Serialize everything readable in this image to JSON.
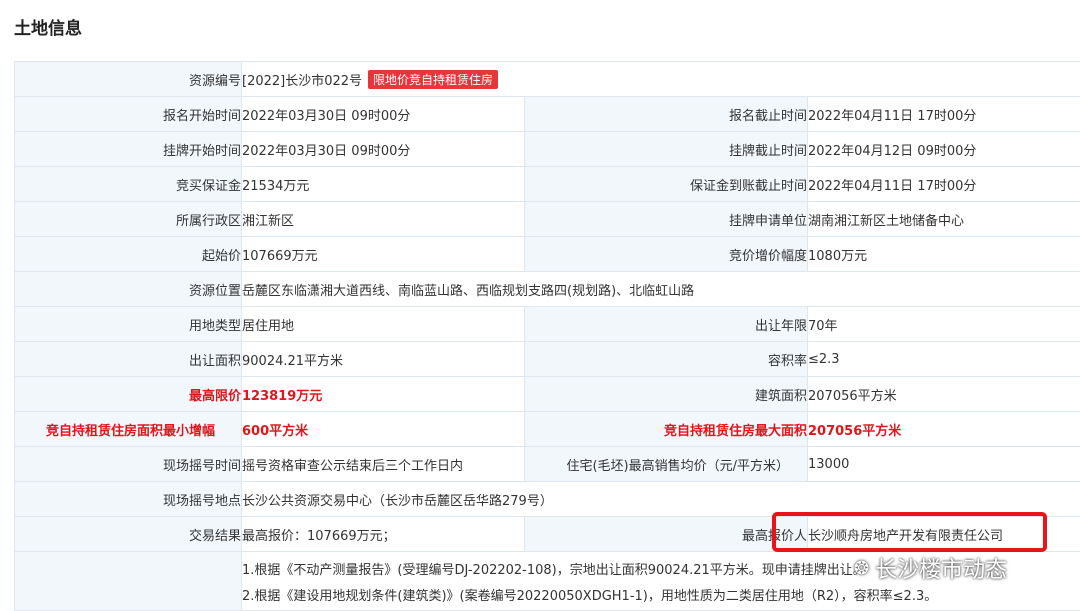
{
  "section_title": "土地信息",
  "rows": [
    {
      "label": "资源编号",
      "value": "[2022]长沙市022号",
      "tag": "限地价竞自持租赁住房"
    },
    {
      "label": "报名开始时间",
      "value": "2022年03月30日 09时00分",
      "label2": "报名截止时间",
      "value2": "2022年04月11日 17时00分"
    },
    {
      "label": "挂牌开始时间",
      "value": "2022年03月30日 09时00分",
      "label2": "挂牌截止时间",
      "value2": "2022年04月12日 09时00分"
    },
    {
      "label": "竞买保证金",
      "value": "21534万元",
      "label2": "保证金到账截止时间",
      "value2": "2022年04月11日 17时00分"
    },
    {
      "label": "所属行政区",
      "value": "湘江新区",
      "label2": "挂牌申请单位",
      "value2": "湖南湘江新区土地储备中心"
    },
    {
      "label": "起始价",
      "value": "107669万元",
      "label2": "竞价增价幅度",
      "value2": "1080万元"
    },
    {
      "label": "资源位置",
      "value": "岳麓区东临潇湘大道西线、南临蓝山路、西临规划支路四(规划路)、北临虹山路"
    },
    {
      "label": "用地类型",
      "value": "居住用地",
      "label2": "出让年限",
      "value2": "70年"
    },
    {
      "label": "出让面积",
      "value": "90024.21平方米",
      "label2": "容积率",
      "value2": "≤2.3"
    },
    {
      "label": "最高限价",
      "value": "123819万元",
      "label2": "建筑面积",
      "value2": "207056平方米"
    },
    {
      "label": "竞自持租赁住房面积最小增幅",
      "value": "600平方米",
      "label2": "竞自持租赁住房最大面积",
      "value2": "207056平方米"
    },
    {
      "label": "现场摇号时间",
      "value": "摇号资格审查公示结束后三个工作日内",
      "label2": "住宅(毛坯)最高销售均价（元/平方米）",
      "value2": "13000"
    },
    {
      "label": "现场摇号地点",
      "value": "长沙公共资源交易中心（长沙市岳麓区岳华路279号）"
    },
    {
      "label": "交易结果",
      "value": "最高报价：107669万元；",
      "label2": "最高报价人",
      "value2": "长沙顺舟房地产开发有限责任公司"
    }
  ],
  "notes": [
    "1.根据《不动产测量报告》(受理编号DJ-202202-108)，宗地出让面积90024.21平方米。现申请挂牌出让。",
    "2.根据《建设用地规划条件(建筑类)》(案卷编号20220050XDGH1-1)，用地性质为二类居住用地（R2），容积率≤2.3。"
  ],
  "watermark": "长沙楼市动态",
  "colors": {
    "accent_red": "#e0161c",
    "label_bg": "#f2f7fc",
    "border": "#dfe6ee",
    "tag_bg": "#e9343b"
  }
}
